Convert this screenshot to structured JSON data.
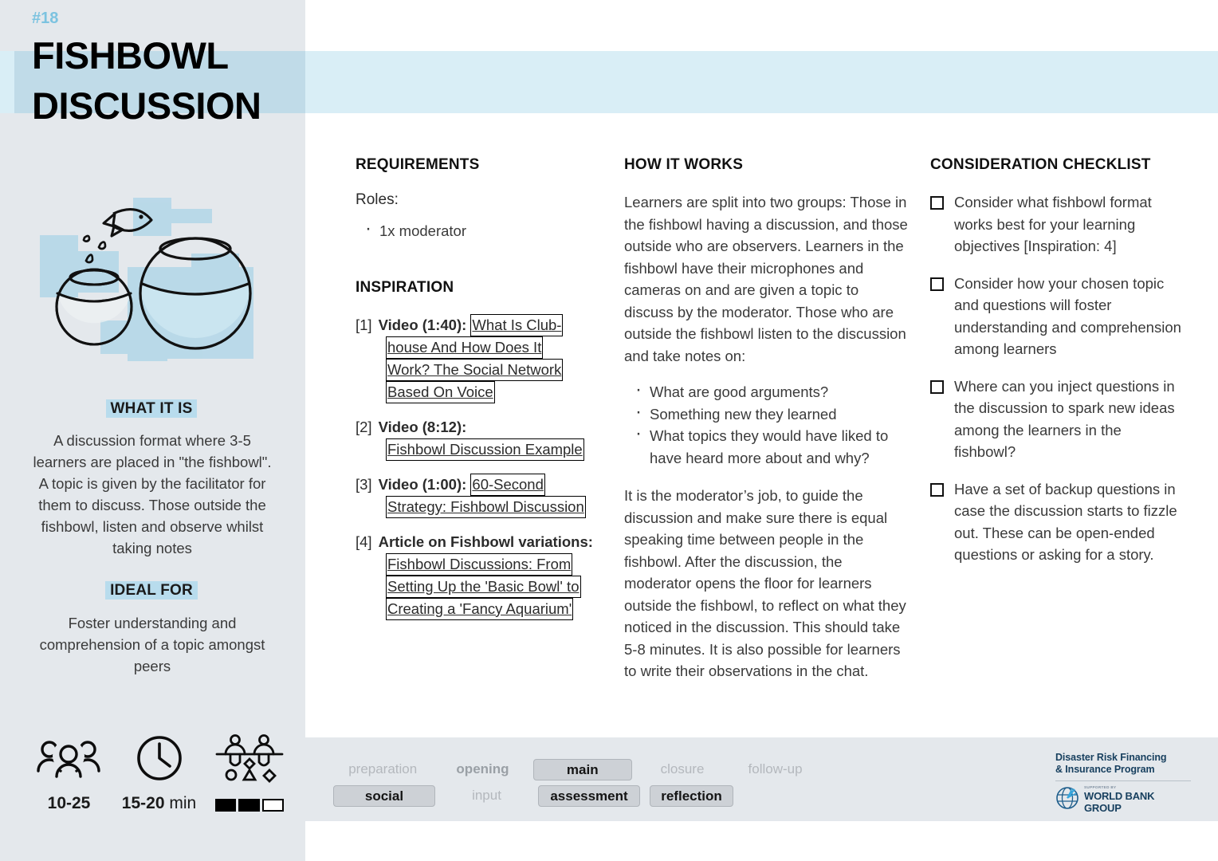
{
  "card": {
    "issue_number": "#18",
    "title_line1": "FISHBOWL",
    "title_line2": "DISCUSSION",
    "accent_color": "#7cc3e0",
    "header_band_color": "#d9eef6",
    "sidebar_color": "#e4e8ec",
    "highlight_color": "#b8dced"
  },
  "sidebar": {
    "illustration_name": "fishbowl-illustration",
    "what_it_is": {
      "heading": "WHAT IT IS",
      "body": "A discussion format where 3-5 learners are placed in \"the fishbowl\". A topic is given by the facilitator for them to discuss. Those outside the fishbowl, listen and observe whilst taking notes"
    },
    "ideal_for": {
      "heading": "IDEAL FOR",
      "body": "Foster understanding and comprehension of a topic amongst peers"
    },
    "meta": {
      "participants_icon": "people-group-icon",
      "participants_value": "10-25",
      "duration_icon": "clock-icon",
      "duration_value": "15-20",
      "duration_unit": " min",
      "complexity_icon": "complexity-icon",
      "complexity_filled": 2,
      "complexity_total": 3
    }
  },
  "requirements": {
    "title": "REQUIREMENTS",
    "roles_label": "Roles:",
    "roles": [
      "1x moderator"
    ]
  },
  "inspiration": {
    "title": "INSPIRATION",
    "items": [
      {
        "index": "[1]",
        "kind": "Video (1:40):",
        "link_lines": [
          "What Is Club-",
          "house And How Does It",
          "Work? The Social Network",
          "Based On Voice"
        ],
        "first_line_inline": true
      },
      {
        "index": "[2]",
        "kind": "Video (8:12):",
        "link_lines": [
          "Fishbowl Discussion Example"
        ],
        "first_line_inline": false
      },
      {
        "index": "[3]",
        "kind": "Video (1:00):",
        "link_lines": [
          "60-Second",
          "Strategy: Fishbowl Discussion"
        ],
        "first_line_inline": true
      },
      {
        "index": "[4]",
        "kind": "Article on Fishbowl variations:",
        "link_lines": [
          "Fishbowl Discussions: From",
          "Setting Up the 'Basic Bowl' to",
          "Creating a 'Fancy Aquarium'"
        ],
        "first_line_inline": false
      }
    ]
  },
  "how_it_works": {
    "title": "HOW IT WORKS",
    "paragraph1": "Learners are split into two groups: Those in the fishbowl having a discussion, and those outside who are observers. Learners in the fishbowl have their microphones and cameras on and are given a topic to discuss by the moderator. Those who are outside the fishbowl listen to the discussion and take notes on:",
    "bullets": [
      "What are good arguments?",
      "Something new they learned",
      "What topics they would have liked to have heard more about and why?"
    ],
    "paragraph2": "It is the moderator’s job, to guide the discussion and make sure there is equal speaking time between people in the fishbowl. After the discussion, the moderator opens the floor for learners outside the fishbowl, to reflect on what they noticed in the discussion. This should take 5-8 minutes. It is also possible for learners to write their observations in the chat."
  },
  "checklist": {
    "title": "CONSIDERATION CHECKLIST",
    "items": [
      "Consider what fishbowl format works best for your learning objectives [Inspiration: 4]",
      "Consider how your chosen topic and questions will foster understanding and comprehension among learners",
      "Where can you inject questions in the discussion to spark new ideas among the learners in the fishbowl?",
      "Have a set of backup questions in case the discussion starts to fizzle out. These can be open-ended questions or asking for a story."
    ]
  },
  "footer": {
    "tags_row1": [
      {
        "label": "preparation",
        "state": "plain",
        "slot": "s-prep"
      },
      {
        "label": "opening",
        "state": "plain-dark",
        "slot": "s-open"
      },
      {
        "label": "main",
        "state": "boxed",
        "slot": "s-main"
      },
      {
        "label": "closure",
        "state": "plain",
        "slot": "s-clos"
      },
      {
        "label": "follow-up",
        "state": "plain",
        "slot": "s-foll"
      }
    ],
    "tags_row2": [
      {
        "label": "social",
        "state": "boxed",
        "slot": "s-prep"
      },
      {
        "label": "input",
        "state": "plain",
        "slot": "s-open"
      },
      {
        "label": "assessment",
        "state": "boxed",
        "slot": "s-main"
      },
      {
        "label": "reflection",
        "state": "boxed",
        "slot": "s-clos"
      }
    ],
    "logo": {
      "program_line1": "Disaster Risk Financing",
      "program_line2": "& Insurance Program",
      "supported_by": "SUPPORTED BY",
      "organization": "WORLD BANK GROUP"
    }
  }
}
